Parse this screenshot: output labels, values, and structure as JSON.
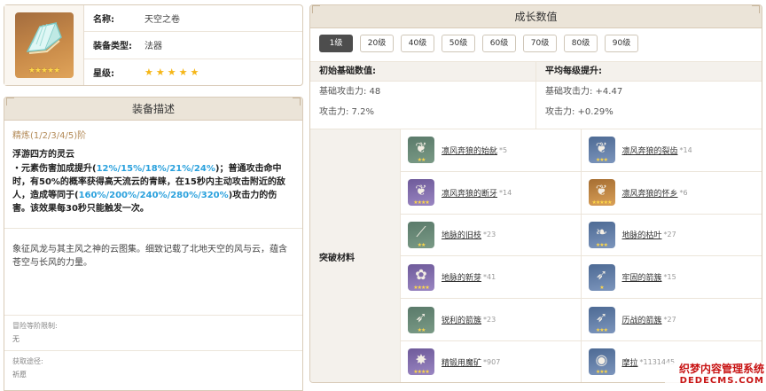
{
  "item": {
    "name_label": "名称:",
    "name_value": "天空之卷",
    "type_label": "装备类型:",
    "type_value": "法器",
    "rarity_label": "星级:",
    "rarity_stars": 5,
    "star_glyph": "★",
    "thumb_icon": "book-with-wings-icon"
  },
  "description": {
    "header": "装备描述",
    "refine": "精炼(1/2/3/4/5)阶",
    "passive_name": "浮游四方的灵云",
    "passive_p1": "・元素伤害加成提升(",
    "passive_v1": "12%/15%/18%/21%/24%",
    "passive_p2": ")；普通攻击命中时，有50%的概率获得高天流云的青睐，在15秒内主动攻击附近的敌人，造成等同于(",
    "passive_v2": "160%/200%/240%/280%/320%",
    "passive_p3": ")攻击力的伤害。该效果每30秒只能触发一次。",
    "lore": "象征风龙与其主风之神的云图集。细致记载了北地天空的风与云，蕴含苍空与长风的力量。",
    "level_limit_label": "冒险等阶限制:",
    "level_limit_value": "无",
    "obtain_label": "获取途径:",
    "obtain_value": "祈愿"
  },
  "growth": {
    "header": "成长数值",
    "levels": [
      "1级",
      "20级",
      "40级",
      "50级",
      "60级",
      "70级",
      "80级",
      "90级"
    ],
    "active_level": 0,
    "base_title": "初始基础数值:",
    "base_atk": "基础攻击力: 48",
    "base_sub": "攻击力: 7.2%",
    "avg_title": "平均每级提升:",
    "avg_atk": "基础攻击力: +4.47",
    "avg_sub": "攻击力: +0.29%",
    "materials_label": "突破材料",
    "materials": [
      {
        "name": "凛风奔狼的始龀",
        "count": "*5",
        "icon": "fang-icon",
        "rarity": "r2",
        "stars": 2
      },
      {
        "name": "凛风奔狼的裂齿",
        "count": "*14",
        "icon": "fang-icon",
        "rarity": "r3",
        "stars": 3
      },
      {
        "name": "凛风奔狼的断牙",
        "count": "*14",
        "icon": "fang-icon",
        "rarity": "r4",
        "stars": 4
      },
      {
        "name": "凛风奔狼的怀乡",
        "count": "*6",
        "icon": "fang-icon",
        "rarity": "r5",
        "stars": 5
      },
      {
        "name": "地脉的旧枝",
        "count": "*23",
        "icon": "branch-icon",
        "rarity": "r2",
        "stars": 2
      },
      {
        "name": "地脉的枯叶",
        "count": "*27",
        "icon": "leaf-icon",
        "rarity": "r3",
        "stars": 3
      },
      {
        "name": "地脉的新芽",
        "count": "*41",
        "icon": "sprout-icon",
        "rarity": "r4",
        "stars": 4
      },
      {
        "name": "牢固的箭簇",
        "count": "*15",
        "icon": "arrowhead-icon",
        "rarity": "r3",
        "stars": 1
      },
      {
        "name": "锐利的箭簇",
        "count": "*23",
        "icon": "arrowhead-icon",
        "rarity": "r2",
        "stars": 2
      },
      {
        "name": "历战的箭簇",
        "count": "*27",
        "icon": "arrowhead-icon",
        "rarity": "r3",
        "stars": 3
      },
      {
        "name": "精锻用魔矿",
        "count": "*907",
        "icon": "ore-icon",
        "rarity": "r4",
        "stars": 4
      },
      {
        "name": "摩拉",
        "count": "*1131445",
        "icon": "mora-coin-icon",
        "rarity": "r3",
        "stars": 3
      }
    ]
  },
  "watermark": {
    "cn": "织梦内容管理系统",
    "en": "DEDECMS.COM"
  }
}
